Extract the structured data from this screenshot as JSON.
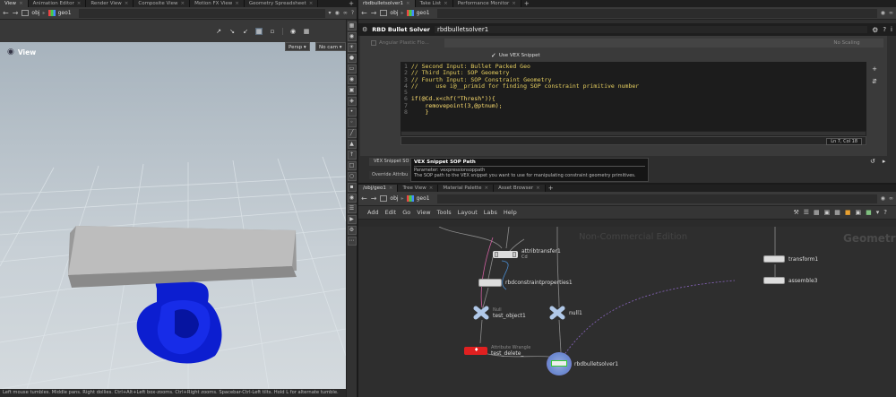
{
  "left_tabs": [
    {
      "label": "View",
      "close": "×"
    },
    {
      "label": "Animation Editor",
      "close": "×"
    },
    {
      "label": "Render View",
      "close": "×"
    },
    {
      "label": "Composite View",
      "close": "×"
    },
    {
      "label": "Motion FX View",
      "close": "×"
    },
    {
      "label": "Geometry Spreadsheet",
      "close": "×"
    }
  ],
  "left_nav": {
    "path_obj": "obj",
    "path_geo": "geo1"
  },
  "viewport": {
    "title": "View",
    "persp_label": "Persp ▾",
    "cam_label": "No cam ▾"
  },
  "status_bar": "Left mouse tumbles. Middle pans. Right dollies. Ctrl+Alt+Left box-zooms. Ctrl+Right zooms. Spacebar-Ctrl-Left tilts. Hold L for alternate tumble.",
  "right_top_tabs": [
    {
      "label": "rbdbulletsolver1",
      "close": "×"
    },
    {
      "label": "Take List",
      "close": "×"
    },
    {
      "label": "Performance Monitor",
      "close": "×"
    }
  ],
  "right_top_nav": {
    "path_obj": "obj",
    "path_geo": "geo1"
  },
  "params": {
    "node_type": "RBD Bullet Solver",
    "node_name": "rbdbulletsolver1",
    "angular_label": "Angular Plastic Flo...",
    "scaling_label": "No Scaling",
    "use_vex_label": "Use VEX Snippet",
    "code_lines": [
      {
        "n": "1",
        "t": "// Second Input: Bullet Packed Geo"
      },
      {
        "n": "2",
        "t": "// Third Input: SOP Geometry"
      },
      {
        "n": "3",
        "t": "// Fourth Input: SOP Constraint Geometry"
      },
      {
        "n": "4",
        "t": "//     use i@__primid for finding SOP constraint primitive number"
      },
      {
        "n": "5",
        "t": ""
      },
      {
        "n": "6",
        "t": "if(@Cd.x<chf(\"Thresh\")){"
      },
      {
        "n": "7",
        "t": "    removepoint(3,@ptnum);"
      },
      {
        "n": "8",
        "t": "    }"
      }
    ],
    "cursor_pos": "Ln 7, Col 18",
    "vex_sop_tab": "VEX Snippet SO",
    "override_tab": "Override Attribu"
  },
  "tooltip": {
    "title": "VEX Snippet SOP Path",
    "param": "Parameter: vexpressionsoppath",
    "desc": "The SOP path to the VEX snippet you want to use for manipulating constraint geometry primitives."
  },
  "right_bottom_tabs": [
    {
      "label": "/obj/geo1",
      "close": "×"
    },
    {
      "label": "Tree View",
      "close": "×"
    },
    {
      "label": "Material Palette",
      "close": "×"
    },
    {
      "label": "Asset Browser",
      "close": "×"
    }
  ],
  "right_bottom_nav": {
    "path_obj": "obj",
    "path_geo": "geo1"
  },
  "net_menu": [
    "Add",
    "Edit",
    "Go",
    "View",
    "Tools",
    "Layout",
    "Labs",
    "Help"
  ],
  "network": {
    "watermark1": "Non-Commercial Edition",
    "watermark2": "Geometry",
    "nodes": [
      {
        "id": "attribtransfer1",
        "label": "attribtransfer1",
        "sub": "Cd"
      },
      {
        "id": "rbdconstraintproperties1",
        "label": "rbdconstraintproperties1",
        "sub": ""
      },
      {
        "id": "test_object1",
        "label": "test_object1",
        "sub": "Null"
      },
      {
        "id": "null1",
        "label": "null1",
        "sub": ""
      },
      {
        "id": "test_delete_",
        "label": "test_delete_",
        "sub": "Attribute Wrangle"
      },
      {
        "id": "rbdbulletsolver1",
        "label": "rbdbulletsolver1",
        "sub": ""
      },
      {
        "id": "transform1",
        "label": "transform1",
        "sub": ""
      },
      {
        "id": "assemble3",
        "label": "assemble3",
        "sub": ""
      }
    ]
  }
}
